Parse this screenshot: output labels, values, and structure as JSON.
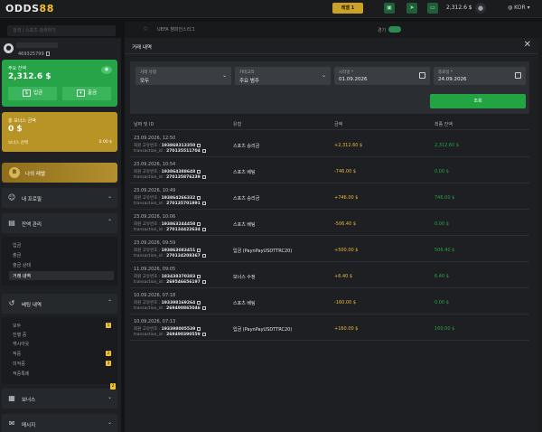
{
  "topbar": {
    "logo_text": "ODDS",
    "logo_num": "88",
    "vip_label": "레벨 1",
    "balance": "2,312.6 $",
    "lang": "KOR"
  },
  "background": {
    "search_placeholder": "검색 / 스포츠 검색하기",
    "tab_label": "UEFA 챔피언스리그",
    "toggle_label": "경기"
  },
  "sidebar": {
    "profile_id": "469325799",
    "main_balance_label": "주요 잔액",
    "main_balance": "2,312.6 $",
    "deposit_label": "입금",
    "withdraw_label": "출금",
    "bonus_label": "총 보너스 금액",
    "bonus_amount": "0 $",
    "bonus_bet_label": "보너스 잔액",
    "bonus_bet_value": "0.00 $",
    "level_label": "나의 레벨",
    "nav": {
      "profile": "내 프로필",
      "wallet": "잔액 관리",
      "betting": "베팅 내역",
      "bonus": "보너스",
      "bonus_badge": "2",
      "messages": "메시지"
    },
    "wallet_items": [
      "입금",
      "출금",
      "출금 상태",
      "거래 내역"
    ],
    "betting_items": [
      {
        "label": "모두",
        "count": "5"
      },
      {
        "label": "진행 중",
        "count": ""
      },
      {
        "label": "캐시아웃",
        "count": ""
      },
      {
        "label": "적중",
        "count": "2"
      },
      {
        "label": "미적중",
        "count": "3"
      },
      {
        "label": "적중특례",
        "count": ""
      }
    ]
  },
  "modal": {
    "title": "거래 내역",
    "close": "✕",
    "filters": {
      "type_label": "거래 유형",
      "type_value": "모두",
      "category_label": "카테고리",
      "category_value": "주요 범주",
      "start_label": "시작일 *",
      "start_value": "01.09.2026",
      "end_label": "종료일 *",
      "end_value": "24.09.2026",
      "search_button": "조회"
    },
    "columns": [
      "날짜 및 ID",
      "유형",
      "금액",
      "최종 잔액"
    ],
    "rows": [
      {
        "date": "23.09.2026, 12:50",
        "wallet_label": "회원 고유번호 :",
        "wallet_id": "193868313350",
        "tx_label": "transaction_id :",
        "tx_id": "270135511704",
        "type": "스포츠 승리금",
        "amount": "+2,312.60  $",
        "final": "2,312.60  $"
      },
      {
        "date": "23.09.2026, 10:54",
        "wallet_label": "회원 고유번호 :",
        "wallet_id": "193864388648",
        "tx_label": "transaction_id :",
        "tx_id": "270135876239",
        "type": "스포츠 베팅",
        "amount": "-746.00  $",
        "final": "0.00  $"
      },
      {
        "date": "23.09.2026, 10:49",
        "wallet_label": "회원 고유번호 :",
        "wallet_id": "193864266332",
        "tx_label": "transaction_id :",
        "tx_id": "270135701891",
        "type": "스포츠 승리금",
        "amount": "+746.00  $",
        "final": "746.00  $"
      },
      {
        "date": "23.09.2026, 10:06",
        "wallet_label": "회원 고유번호 :",
        "wallet_id": "193863244458",
        "tx_label": "transaction_id :",
        "tx_id": "270134422634",
        "type": "스포츠 베팅",
        "amount": "-506.40  $",
        "final": "0.00  $"
      },
      {
        "date": "23.09.2026, 09:59",
        "wallet_label": "회원 고유번호 :",
        "wallet_id": "193863083451",
        "tx_label": "transaction_id :",
        "tx_id": "270134208367",
        "type": "입금 (PaynPayUSDTTRC20)",
        "amount": "+500.00  $",
        "final": "506.40  $"
      },
      {
        "date": "11.09.2026, 09:05",
        "wallet_label": "회원 고유번호 :",
        "wallet_id": "183438370383",
        "tx_label": "transaction_id :",
        "tx_id": "269546656197",
        "type": "보너스 수정",
        "amount": "+6.40  $",
        "final": "6.40  $"
      },
      {
        "date": "10.09.2026, 07:18",
        "wallet_label": "회원 고유번호 :",
        "wallet_id": "193398169264",
        "tx_label": "transaction_id :",
        "tx_id": "269490865046",
        "type": "스포츠 베팅",
        "amount": "-160.00  $",
        "final": "0.00  $"
      },
      {
        "date": "10.09.2026, 07:13",
        "wallet_label": "회원 고유번호 :",
        "wallet_id": "193398005539",
        "tx_label": "transaction_id :",
        "tx_id": "269490390559",
        "type": "입금 (PaynPayUSDTTRC20)",
        "amount": "+160.00  $",
        "final": "160.00  $"
      }
    ]
  },
  "colors": {
    "green": "#27a348",
    "gold": "#b89426",
    "amount": "#e7b93a",
    "bg": "#121314"
  }
}
